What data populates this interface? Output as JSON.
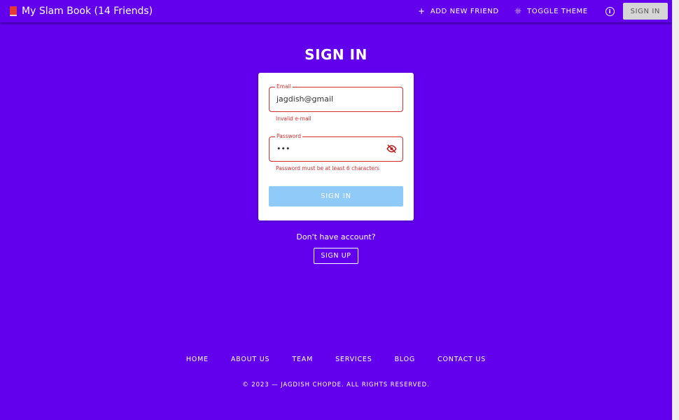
{
  "appbar": {
    "title": "My Slam Book (14 Friends)",
    "add_friend_label": "ADD NEW FRIEND",
    "toggle_theme_label": "TOGGLE THEME",
    "signin_label": "SIGN IN"
  },
  "page": {
    "title": "SIGN IN"
  },
  "form": {
    "email": {
      "label": "Email",
      "value": "jagdish@gmail",
      "error": "Invalid e-mail"
    },
    "password": {
      "label": "Password",
      "value": "•••",
      "error": "Password must be at least 6 characters"
    },
    "submit_label": "SIGN IN"
  },
  "signup": {
    "prompt": "Don't have account?",
    "button_label": "SIGN UP"
  },
  "footer": {
    "links": [
      "HOME",
      "ABOUT US",
      "TEAM",
      "SERVICES",
      "BLOG",
      "CONTACT US"
    ],
    "copyright": "© 2023 — JAGDISH CHOPDE. ALL RIGHTS RESERVED."
  },
  "colors": {
    "primary": "#6200ee",
    "error": "#d32f2f",
    "disabled_button": "#90caf9",
    "brand_icon": "#e53935"
  },
  "icons": [
    "book-icon",
    "plus-icon",
    "sun-icon",
    "info-icon",
    "eye-off-icon"
  ]
}
